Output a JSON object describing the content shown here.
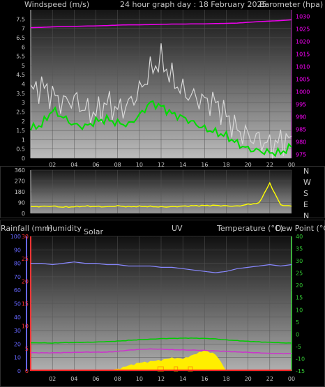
{
  "header": {
    "windspeed_label": "Windspeed (m/s)",
    "title": "24 hour graph day : 18 February 2025",
    "barometer_label": "Barometer (hpa)"
  },
  "panel3_header": {
    "rainfall_label": "Rainfall (mm)",
    "humidity_label": "Humidity",
    "solar_label": "Solar",
    "uv_label": "UV",
    "temperature_label": "Temperature (°C)",
    "dewpoint_label": "Dew Point (°C)"
  },
  "direction_labels": [
    "N",
    "W",
    "S",
    "E",
    "N"
  ],
  "colors": {
    "wind_gust": "#d8d8d8",
    "wind_avg": "#00dd00",
    "barometer": "#ee00ee",
    "direction": "#ffff00",
    "humidity": "#8888ff",
    "temperature": "#00cc00",
    "dewpoint": "#cc33cc",
    "solar": "#ffee00",
    "uv": "#ff9900",
    "rain": "#ff2222",
    "axis_wind": "#c8c8c8",
    "axis_baro": "#ff00ff",
    "axis_humidity": "#6666ff",
    "axis_rain": "#ff3333",
    "axis_temp": "#33cc33"
  },
  "chart_data": [
    {
      "type": "line",
      "name": "wind-barometer",
      "x_ticks": [
        "02",
        "04",
        "06",
        "08",
        "10",
        "12",
        "14",
        "16",
        "18",
        "20",
        "22",
        "00"
      ],
      "y_left_ticks": [
        "0",
        "0.5",
        "1",
        "1.5",
        "2",
        "2.5",
        "3",
        "3.5",
        "4",
        "4.5",
        "5",
        "5.5",
        "6",
        "6.5",
        "7",
        "7.5"
      ],
      "y_left_lim": [
        0,
        8
      ],
      "y_right_ticks": [
        "975",
        "980",
        "985",
        "990",
        "995",
        "1000",
        "1005",
        "1010",
        "1015",
        "1020",
        "1025",
        "1030"
      ],
      "y_right_lim": [
        973.5,
        1032.6
      ],
      "x": [
        0,
        1,
        2,
        3,
        4,
        5,
        6,
        7,
        8,
        9,
        10,
        11,
        12,
        13,
        14,
        15,
        16,
        17,
        18,
        19,
        20,
        21,
        22,
        23,
        24
      ],
      "series": [
        {
          "values": [
            3.6,
            3.9,
            3.4,
            3.0,
            3.2,
            2.6,
            2.4,
            3.0,
            2.6,
            2.9,
            3.6,
            4.7,
            5.3,
            4.3,
            3.6,
            3.3,
            3.1,
            3.0,
            2.3,
            1.5,
            1.2,
            1.0,
            0.7,
            0.9,
            1.2
          ]
        },
        {
          "values": [
            1.6,
            1.8,
            2.6,
            2.2,
            1.8,
            1.7,
            2.0,
            2.1,
            1.9,
            1.8,
            2.3,
            3.0,
            2.8,
            2.4,
            2.2,
            1.9,
            1.6,
            1.4,
            1.2,
            0.8,
            0.5,
            0.4,
            0.3,
            0.3,
            0.6
          ]
        },
        {
          "values": [
            1025.5,
            1025.6,
            1025.8,
            1025.9,
            1026.0,
            1026.1,
            1026.2,
            1026.3,
            1026.5,
            1026.6,
            1026.6,
            1026.7,
            1026.8,
            1026.9,
            1026.9,
            1027.0,
            1027.0,
            1027.1,
            1027.2,
            1027.3,
            1027.6,
            1027.9,
            1028.1,
            1028.3,
            1028.6
          ]
        }
      ]
    },
    {
      "type": "line",
      "name": "wind-direction",
      "y_ticks": [
        "0",
        "90",
        "180",
        "270",
        "360"
      ],
      "ylim": [
        0,
        360
      ],
      "x": [
        0,
        1,
        2,
        3,
        4,
        5,
        6,
        7,
        8,
        9,
        10,
        11,
        12,
        13,
        14,
        15,
        16,
        17,
        18,
        19,
        20,
        21,
        22,
        23,
        24
      ],
      "series": [
        {
          "values": [
            55,
            58,
            60,
            52,
            55,
            60,
            58,
            55,
            62,
            55,
            58,
            57,
            54,
            55,
            60,
            63,
            65,
            66,
            62,
            60,
            75,
            85,
            250,
            70,
            60
          ]
        }
      ]
    },
    {
      "type": "area",
      "name": "temp-humidity-solar",
      "y_humidity_ticks": [
        "0",
        "10",
        "20",
        "30",
        "40",
        "50",
        "60",
        "70",
        "80",
        "90",
        "100"
      ],
      "y_humidity_lim": [
        0,
        100
      ],
      "y_rain_ticks": [
        "0",
        "5",
        "10",
        "15",
        "20",
        "25",
        "30"
      ],
      "y_rain_lim": [
        0,
        30
      ],
      "y_temp_ticks": [
        "-15",
        "-10",
        "-5",
        "0",
        "5",
        "10",
        "15",
        "20",
        "25",
        "30",
        "35",
        "40"
      ],
      "y_temp_lim": [
        -15,
        40
      ],
      "x": [
        0,
        1,
        2,
        3,
        4,
        5,
        6,
        7,
        8,
        9,
        10,
        11,
        12,
        13,
        14,
        15,
        16,
        17,
        18,
        19,
        20,
        21,
        22,
        23,
        24
      ],
      "series": [
        {
          "values": [
            80,
            80,
            79,
            80,
            81,
            80,
            80,
            79,
            79,
            78,
            78,
            78,
            77,
            77,
            76,
            75,
            74,
            73,
            74,
            76,
            77,
            78,
            79,
            78,
            79
          ]
        },
        {
          "values": [
            -3.5,
            -3.5,
            -3.6,
            -3.4,
            -3.4,
            -3.3,
            -3.2,
            -3.0,
            -2.8,
            -2.5,
            -2.2,
            -2.0,
            -1.8,
            -1.7,
            -1.6,
            -1.6,
            -1.7,
            -1.9,
            -2.3,
            -2.6,
            -2.9,
            -3.1,
            -3.3,
            -3.5,
            -3.6
          ]
        },
        {
          "values": [
            -7.5,
            -7.6,
            -7.6,
            -7.5,
            -7.4,
            -7.3,
            -7.3,
            -7.3,
            -7.0,
            -6.5,
            -6.2,
            -6.0,
            -6.1,
            -6.3,
            -6.4,
            -6.5,
            -6.6,
            -6.8,
            -7.0,
            -7.2,
            -7.4,
            -7.6,
            -7.8,
            -7.9,
            -7.9
          ]
        },
        {
          "values": [
            0,
            0,
            0,
            0,
            0,
            0,
            0,
            0,
            0.2,
            1.0,
            1.6,
            1.9,
            2.2,
            2.7,
            2.5,
            3.4,
            4.4,
            3.5,
            0,
            0,
            0,
            0,
            0,
            0,
            0
          ]
        }
      ]
    }
  ]
}
